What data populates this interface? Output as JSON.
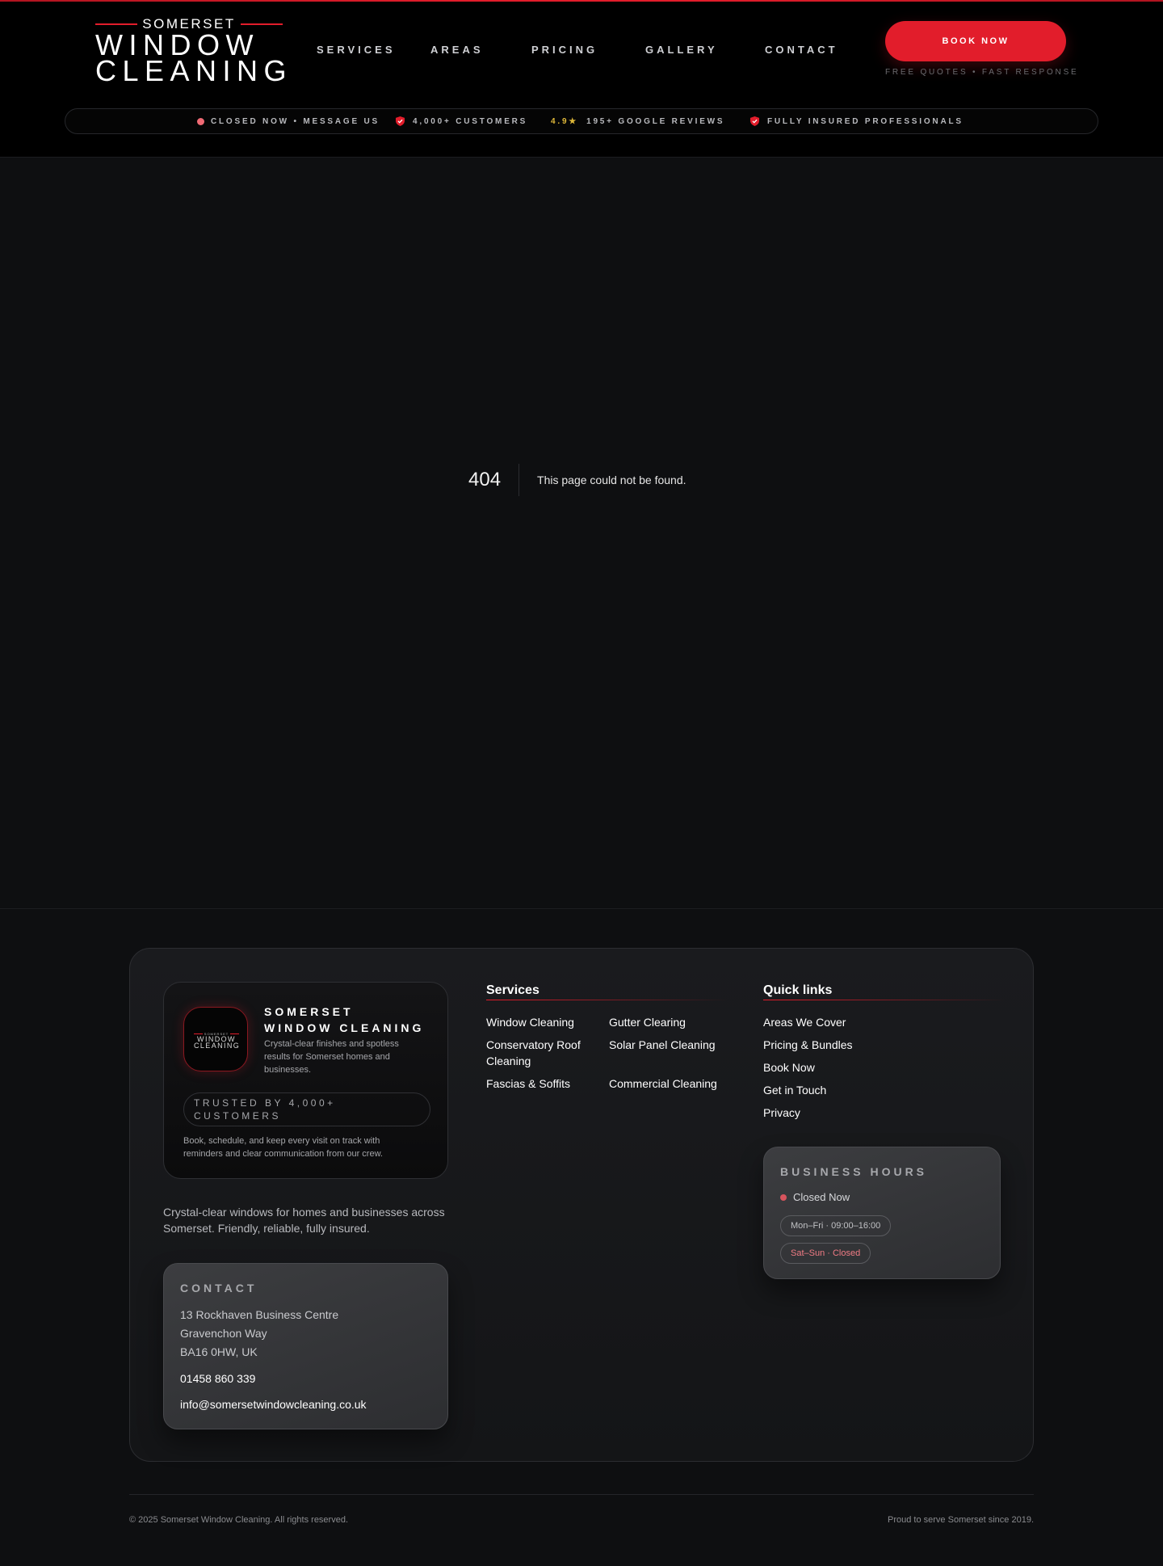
{
  "brand": {
    "logo_top": "SOMERSET",
    "logo_line1": "WINDOW",
    "logo_line2": "CLEANING",
    "accent_color": "#e21d2b"
  },
  "nav": {
    "items": [
      {
        "label": "SERVICES"
      },
      {
        "label": "AREAS"
      },
      {
        "label": "PRICING"
      },
      {
        "label": "GALLERY"
      },
      {
        "label": "CONTACT"
      }
    ],
    "cta": "BOOK NOW",
    "cta_sub": "FREE QUOTES • FAST RESPONSE"
  },
  "trustbar": {
    "status": "CLOSED NOW • MESSAGE US",
    "customers": "4,000+ CUSTOMERS",
    "rating": "4.9★",
    "reviews": "195+ GOOGLE REVIEWS",
    "insured": "FULLY INSURED PROFESSIONALS"
  },
  "error": {
    "code": "404",
    "message": "This page could not be found."
  },
  "footer": {
    "brand_card": {
      "name_line1": "SOMERSET",
      "name_line2": "WINDOW CLEANING",
      "desc": "Crystal-clear finishes and spotless results for Somerset homes and businesses.",
      "trusted": "TRUSTED BY 4,000+ CUSTOMERS",
      "sub": "Book, schedule, and keep every visit on track with reminders and clear communication from our crew.",
      "badge_top": "SOMERSET",
      "badge_l1": "WINDOW",
      "badge_l2": "CLEANING"
    },
    "tagline": "Crystal-clear windows for homes and businesses across Somerset. Friendly, reliable, fully insured.",
    "contact": {
      "title": "CONTACT",
      "address1": "13 Rockhaven Business Centre",
      "address2": "Gravenchon Way",
      "address3": "BA16 0HW, UK",
      "phone": "01458 860 339",
      "email": "info@somersetwindowcleaning.co.uk"
    },
    "services": {
      "title": "Services",
      "items": [
        "Window Cleaning",
        "Gutter Clearing",
        "Conservatory Roof Cleaning",
        "Solar Panel Cleaning",
        "Fascias & Soffits",
        "Commercial Cleaning"
      ]
    },
    "quick_links": {
      "title": "Quick links",
      "items": [
        "Areas We Cover",
        "Pricing & Bundles",
        "Book Now",
        "Get in Touch",
        "Privacy"
      ]
    },
    "hours": {
      "title": "BUSINESS HOURS",
      "status": "Closed Now",
      "weekdays": "Mon–Fri · 09:00–16:00",
      "weekend": "Sat–Sun · Closed"
    },
    "copyright": "© 2025 Somerset Window Cleaning. All rights reserved.",
    "since": "Proud to serve Somerset since 2019."
  }
}
